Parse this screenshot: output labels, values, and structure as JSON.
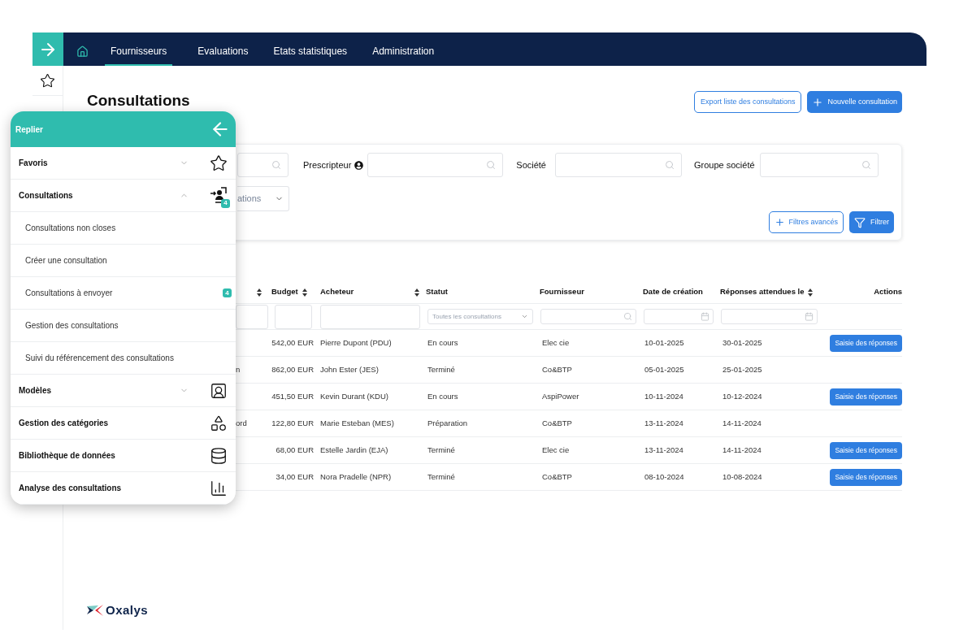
{
  "nav": {
    "tabs": [
      {
        "label": "Fournisseurs",
        "selected": true
      },
      {
        "label": "Evaluations",
        "selected": false
      },
      {
        "label": "Etats statistiques",
        "selected": false
      },
      {
        "label": "Administration",
        "selected": false
      }
    ]
  },
  "page": {
    "title": "Consultations",
    "export_button": "Export liste des consultations",
    "new_button": "Nouvelle consultation"
  },
  "filters": {
    "fields": [
      {
        "kind": "search"
      },
      {
        "kind": "search",
        "label": "Prescripteur"
      },
      {
        "kind": "search",
        "label": "Société"
      },
      {
        "kind": "search",
        "label": "Groupe société"
      }
    ],
    "dropdown_value": "ations",
    "advanced_button": "Filtres avancés",
    "filter_button": "Filtrer"
  },
  "table": {
    "columns": [
      {
        "sortable": true
      },
      {
        "label": "Budget",
        "sortable": true
      },
      {
        "label": "Acheteur",
        "sortable": true
      },
      {
        "label": "Statut",
        "sortable": false
      },
      {
        "label": "Fournisseur",
        "sortable": false
      },
      {
        "label": "Date de création",
        "sortable": false
      },
      {
        "label": "Réponses attendues le",
        "sortable": true
      },
      {
        "label": "Actions",
        "sortable": false
      }
    ],
    "filter_row": {
      "status_value": "Toutes les consultations"
    },
    "rows": [
      {
        "budget": "542,00 EUR",
        "buyer": "Pierre Dupont (PDU)",
        "status": "En cours",
        "supplier": "Elec cie",
        "created": "10-01-2025",
        "due": "30-01-2025",
        "action": "Saisie des réponses"
      },
      {
        "column_1": "n",
        "budget": "862,00 EUR",
        "buyer": "John Ester (JES)",
        "status": "Terminé",
        "supplier": "Co&BTP",
        "created": "05-01-2025",
        "due": "25-01-2025"
      },
      {
        "budget": "451,50 EUR",
        "buyer": "Kevin Durant (KDU)",
        "status": "En cours",
        "supplier": "AspiPower",
        "created": "10-11-2024",
        "due": "10-12-2024",
        "action": "Saisie des réponses"
      },
      {
        "column_1": "ord",
        "budget": "122,80 EUR",
        "buyer": "Marie Esteban (MES)",
        "status": "Préparation",
        "supplier": "Co&BTP",
        "created": "13-11-2024",
        "due": "14-11-2024"
      },
      {
        "budget": "68,00 EUR",
        "buyer": "Estelle Jardin (EJA)",
        "status": "Terminé",
        "supplier": "Elec cie",
        "created": "13-11-2024",
        "due": "14-11-2024",
        "action": "Saisie des réponses"
      },
      {
        "budget": "34,00 EUR",
        "buyer": "Nora Pradelle (NPR)",
        "status": "Terminé",
        "supplier": "Co&BTP",
        "created": "08-10-2024",
        "due": "10-08-2024",
        "action": "Saisie des réponses"
      }
    ]
  },
  "logo": {
    "text": "Oxalys"
  },
  "menu": {
    "header": "Replier",
    "sections": [
      {
        "kind": "favorites",
        "label": "Favoris",
        "expanded": false
      },
      {
        "kind": "consultations",
        "label": "Consultations",
        "expanded": true,
        "badge": "4",
        "children": [
          {
            "label": "Consultations non closes"
          },
          {
            "label": "Créer une consultation"
          },
          {
            "label": "Consultations à envoyer",
            "badge": "4"
          },
          {
            "label": "Gestion des consultations"
          },
          {
            "label": "Suivi du référencement des consultations"
          }
        ]
      },
      {
        "kind": "templates",
        "label": "Modèles",
        "expanded": false
      },
      {
        "kind": "categories",
        "label": "Gestion des catégories"
      },
      {
        "kind": "library",
        "label": "Bibliothèque de données"
      },
      {
        "kind": "analysis",
        "label": "Analyse des consultations"
      }
    ]
  }
}
